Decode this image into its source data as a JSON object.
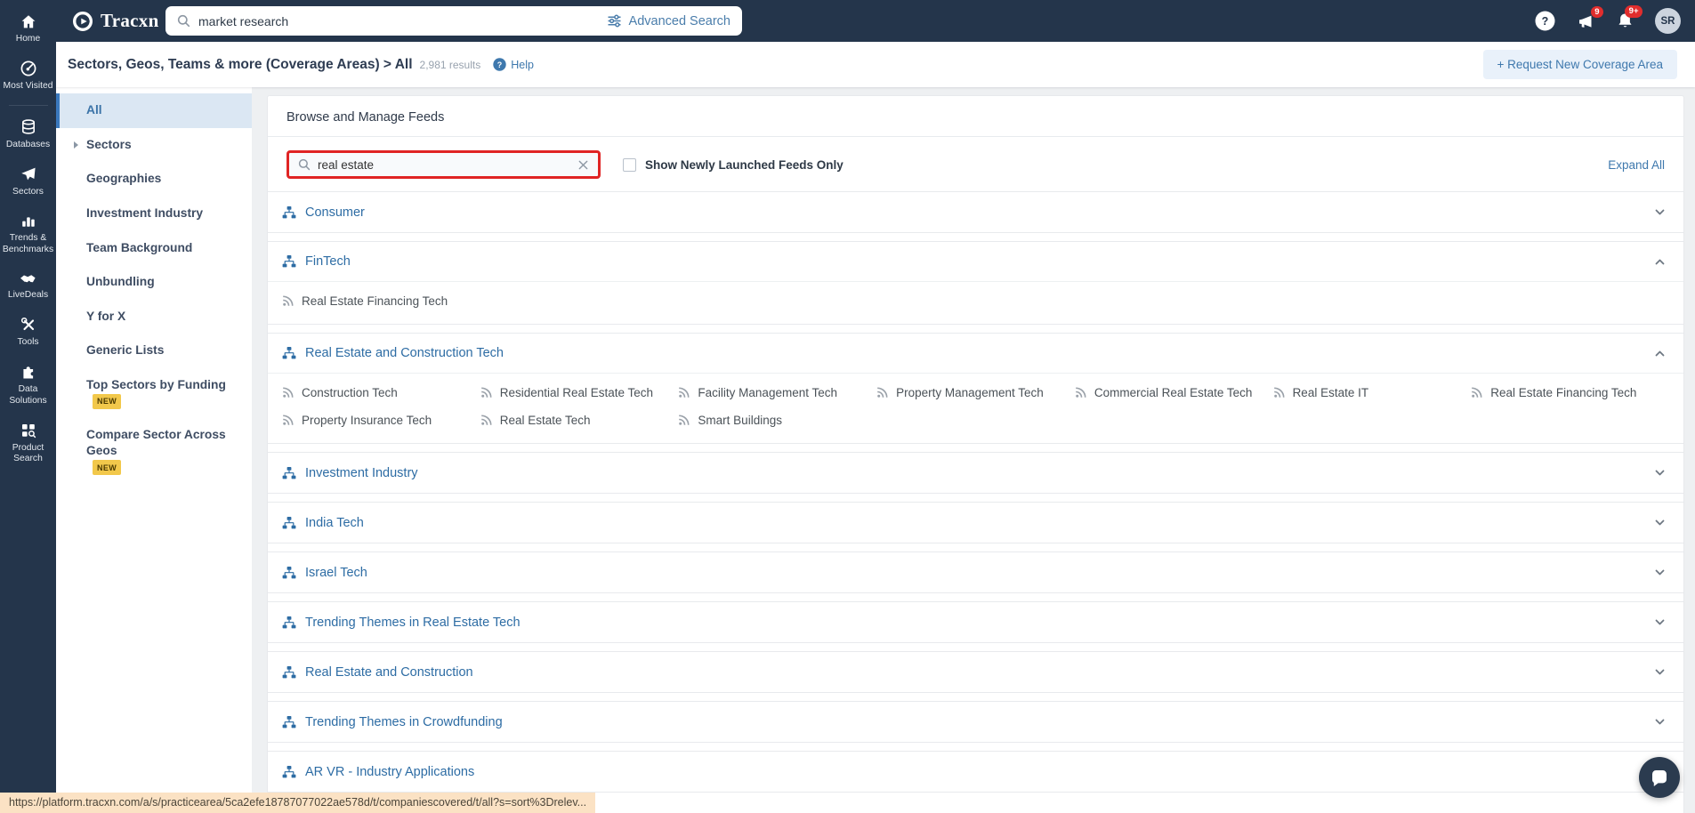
{
  "theme": {
    "navy": "#24354b",
    "blue": "#3e78ad",
    "link_blue": "#4a7dab",
    "red": "#e02424",
    "badge_red": "#e12d2d",
    "yellow": "#f2c84b",
    "selected_bg": "#dbe7f3",
    "page_bg": "#eef0f2",
    "tooltip_bg": "#fbe2c4"
  },
  "topbar": {
    "brand": "Tracxn",
    "search_value": "market research",
    "advanced_search_label": "Advanced Search",
    "announcements_badge": "9",
    "notifications_badge": "9+",
    "avatar_initials": "SR",
    "icons": [
      "help-circle-icon",
      "megaphone-icon",
      "bell-icon"
    ]
  },
  "nav_rail": {
    "items": [
      {
        "label": "Home",
        "icon": "home-icon"
      },
      {
        "label": "Most Visited",
        "icon": "most-visited-icon"
      },
      {
        "label": "Databases",
        "icon": "database-icon"
      },
      {
        "label": "Sectors",
        "icon": "paper-plane-icon"
      },
      {
        "label": "Trends & Benchmarks",
        "icon": "bar-chart-icon"
      },
      {
        "label": "LiveDeals",
        "icon": "handshake-icon"
      },
      {
        "label": "Tools",
        "icon": "tools-icon"
      },
      {
        "label": "Data Solutions",
        "icon": "puzzle-icon"
      },
      {
        "label": "Product Search",
        "icon": "grid-search-icon"
      }
    ]
  },
  "breadcrumb": {
    "title": "Sectors, Geos, Teams & more (Coverage Areas) > All",
    "results_count": "2,981 results",
    "help_label": "Help",
    "request_button_label": "+ Request New Coverage Area"
  },
  "side_panel": {
    "items": [
      {
        "label": "All",
        "selected": true
      },
      {
        "label": "Sectors",
        "expandable": true
      },
      {
        "label": "Geographies"
      },
      {
        "label": "Investment Industry"
      },
      {
        "label": "Team Background"
      },
      {
        "label": "Unbundling"
      },
      {
        "label": "Y for X"
      },
      {
        "label": "Generic Lists"
      },
      {
        "label": "Top Sectors by Funding",
        "badge": "NEW"
      },
      {
        "label": "Compare Sector Across Geos",
        "badge": "NEW"
      }
    ]
  },
  "main": {
    "title": "Browse and Manage Feeds",
    "filter_value": "real estate",
    "checkbox_label": "Show Newly Launched Feeds Only",
    "checkbox_checked": false,
    "expand_all_label": "Expand All",
    "groups": [
      {
        "name": "Consumer",
        "expanded": false,
        "feeds": []
      },
      {
        "name": "FinTech",
        "expanded": true,
        "feeds": [
          "Real Estate Financing Tech"
        ]
      },
      {
        "name": "Real Estate and Construction Tech",
        "expanded": true,
        "feeds": [
          "Construction Tech",
          "Residential Real Estate Tech",
          "Facility Management Tech",
          "Property Management Tech",
          "Commercial Real Estate Tech",
          "Real Estate IT",
          "Real Estate Financing Tech",
          "Property Insurance Tech",
          "Real Estate Tech",
          "Smart Buildings"
        ]
      },
      {
        "name": "Investment Industry",
        "expanded": false,
        "feeds": []
      },
      {
        "name": "India Tech",
        "expanded": false,
        "feeds": []
      },
      {
        "name": "Israel Tech",
        "expanded": false,
        "feeds": []
      },
      {
        "name": "Trending Themes in Real Estate Tech",
        "expanded": false,
        "feeds": []
      },
      {
        "name": "Real Estate and Construction",
        "expanded": false,
        "feeds": []
      },
      {
        "name": "Trending Themes in Crowdfunding",
        "expanded": false,
        "feeds": []
      },
      {
        "name": "AR VR - Industry Applications",
        "expanded": false,
        "feeds": []
      }
    ]
  },
  "statusbar": {
    "url": "https://platform.tracxn.com/a/s/practicearea/5ca2efe18787077022ae578d/t/companiescovered/t/all?s=sort%3Drelev..."
  }
}
